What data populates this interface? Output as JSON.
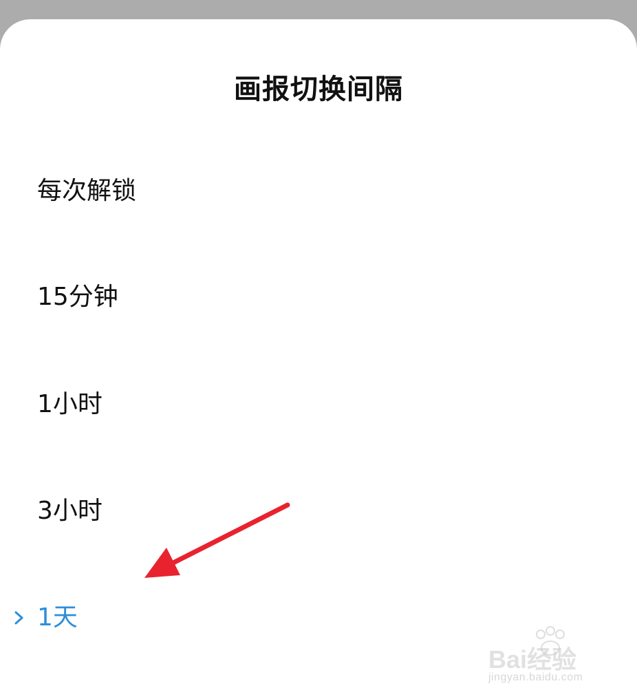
{
  "dialog": {
    "title": "画报切换间隔",
    "options": [
      {
        "label": "每次解锁",
        "selected": false
      },
      {
        "label": "15分钟",
        "selected": false
      },
      {
        "label": "1小时",
        "selected": false
      },
      {
        "label": "3小时",
        "selected": false
      },
      {
        "label": "1天",
        "selected": true
      }
    ]
  },
  "colors": {
    "selected": "#2d8fd8",
    "arrow": "#e8232f",
    "backdrop": "#acacac"
  },
  "watermark": {
    "brand": "Bai经验",
    "url": "jingyan.baidu.com"
  }
}
